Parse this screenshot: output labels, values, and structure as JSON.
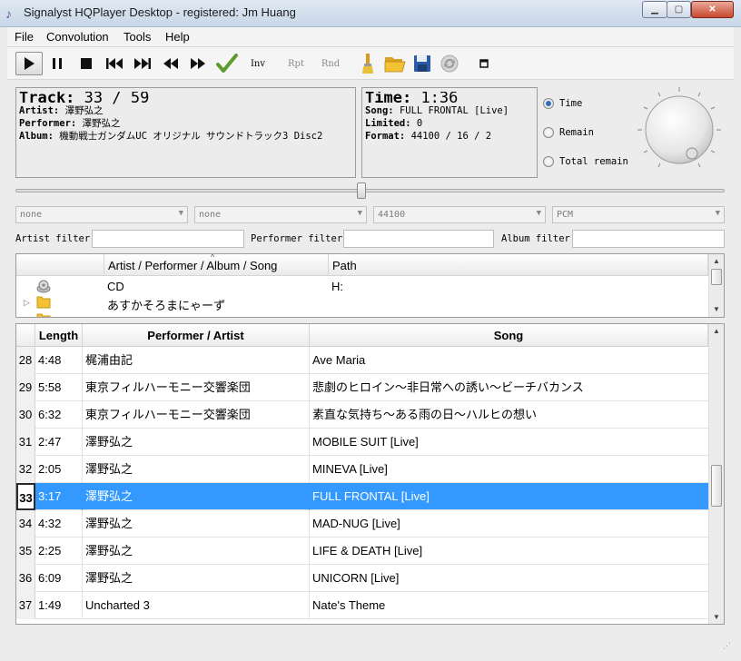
{
  "window": {
    "title": "Signalyst HQPlayer Desktop - registered: Jm Huang"
  },
  "menu": [
    "File",
    "Convolution",
    "Tools",
    "Help"
  ],
  "toolbar": {
    "inv": "Inv",
    "rpt": "Rpt",
    "rnd": "Rnd"
  },
  "track_panel": {
    "track_label": "Track:",
    "track_value": "33 / 59",
    "artist_label": "Artist:",
    "artist": "澤野弘之",
    "performer_label": "Performer:",
    "performer": "澤野弘之",
    "album_label": "Album:",
    "album": "機動戦士ガンダムUC オリジナル サウンドトラック3 Disc2"
  },
  "time_panel": {
    "time_label": "Time:",
    "time_value": "1:36",
    "song_label": "Song:",
    "song": "FULL FRONTAL [Live]",
    "limited_label": "Limited:",
    "limited": "0",
    "format_label": "Format:",
    "format": "44100 / 16 / 2"
  },
  "time_mode": {
    "options": [
      "Time",
      "Remain",
      "Total remain"
    ],
    "selected": "Time"
  },
  "selectors": [
    "none",
    "none",
    "44100",
    "PCM"
  ],
  "filters": {
    "artist": "Artist filter",
    "performer": "Performer filter",
    "album": "Album filter"
  },
  "tree": {
    "headers": [
      "Artist / Performer / Album / Song",
      "Path"
    ],
    "rows": [
      {
        "name": "CD",
        "path": "H:"
      },
      {
        "name": "あすかそろまにゃーず",
        "path": ""
      }
    ]
  },
  "playlist": {
    "headers": [
      "Length",
      "Performer / Artist",
      "Song"
    ],
    "rows": [
      {
        "n": "28",
        "length": "4:48",
        "performer": "梶浦由記",
        "song": "Ave Maria"
      },
      {
        "n": "29",
        "length": "5:58",
        "performer": "東京フィルハーモニー交響楽団",
        "song": "悲劇のヒロイン～非日常への誘い～ビーチバカンス"
      },
      {
        "n": "30",
        "length": "6:32",
        "performer": "東京フィルハーモニー交響楽団",
        "song": "素直な気持ち～ある雨の日～ハルヒの想い"
      },
      {
        "n": "31",
        "length": "2:47",
        "performer": "澤野弘之",
        "song": "MOBILE SUIT [Live]"
      },
      {
        "n": "32",
        "length": "2:05",
        "performer": "澤野弘之",
        "song": "MINEVA [Live]"
      },
      {
        "n": "33",
        "length": "3:17",
        "performer": "澤野弘之",
        "song": "FULL FRONTAL [Live]"
      },
      {
        "n": "34",
        "length": "4:32",
        "performer": "澤野弘之",
        "song": "MAD-NUG [Live]"
      },
      {
        "n": "35",
        "length": "2:25",
        "performer": "澤野弘之",
        "song": "LIFE & DEATH [Live]"
      },
      {
        "n": "36",
        "length": "6:09",
        "performer": "澤野弘之",
        "song": "UNICORN [Live]"
      },
      {
        "n": "37",
        "length": "1:49",
        "performer": "Uncharted 3",
        "song": "Nate's Theme"
      }
    ],
    "selected_row": "33"
  },
  "colors": {
    "selection": "#3399ff",
    "accent": "#2f6fb9",
    "folder": "#f2c233"
  }
}
